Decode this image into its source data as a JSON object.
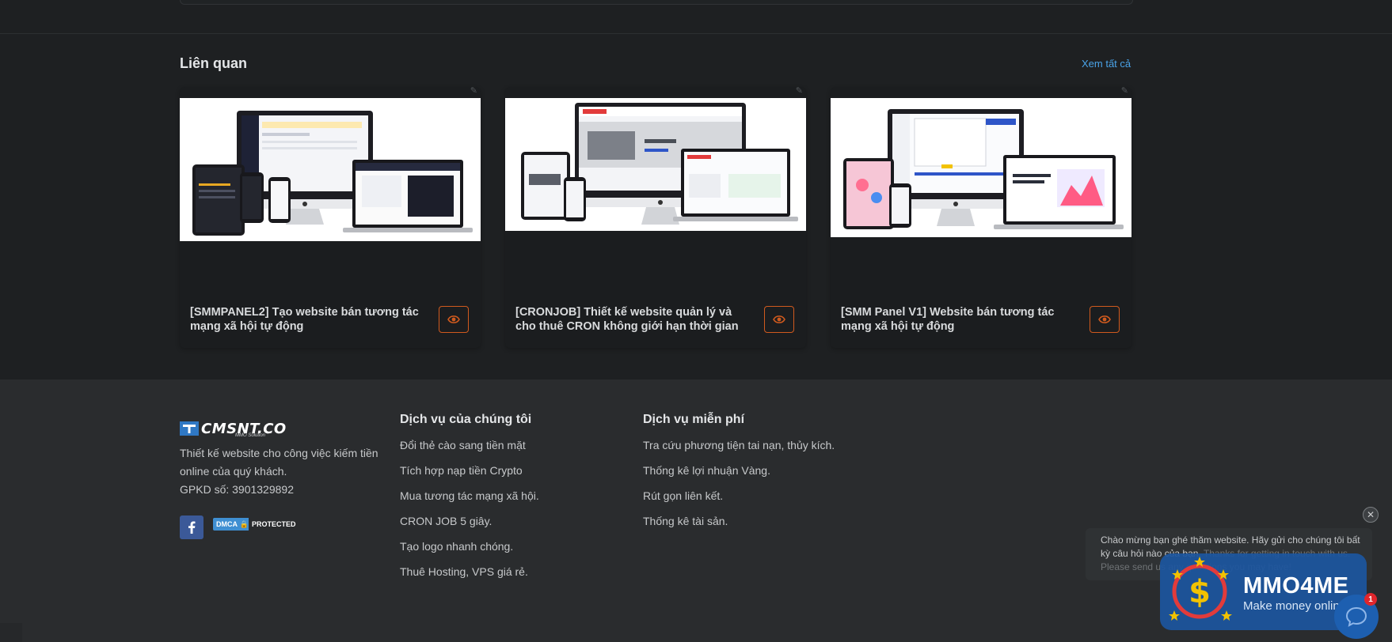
{
  "related": {
    "title": "Liên quan",
    "view_all": "Xem tất cả",
    "cards": [
      {
        "title": "[SMMPANEL2] Tạo website bán tương tác mạng xã hội tự động",
        "icon": "eye-icon"
      },
      {
        "title": "[CRONJOB] Thiết kế website quản lý và cho thuê CRON không giới hạn thời gian",
        "icon": "eye-icon"
      },
      {
        "title": "[SMM Panel V1] Website bán tương tác mạng xã hội tự động",
        "icon": "eye-icon"
      }
    ]
  },
  "footer": {
    "logo_text": "CMSNT.CO",
    "logo_sub": "MMO Solution",
    "about": "Thiết kế website cho công việc kiếm tiền online của quý khách.",
    "license": "GPKD số: 3901329892",
    "dmca_left": "DMCA",
    "dmca_right": "PROTECTED",
    "services_title": "Dịch vụ của chúng tôi",
    "services": [
      "Đổi thẻ cào sang tiền mặt",
      "Tích hợp nạp tiền Crypto",
      "Mua tương tác mạng xã hội.",
      "CRON JOB 5 giây.",
      "Tạo logo nhanh chóng.",
      "Thuê Hosting, VPS giá rẻ."
    ],
    "free_title": "Dịch vụ miễn phí",
    "free_services": [
      "Tra cứu phương tiện tai nạn, thủy kích.",
      "Thống kê lợi nhuận Vàng.",
      "Rút gọn liên kết.",
      "Thống kê tài sản."
    ]
  },
  "chat": {
    "message_vi": "Chào mừng bạn ghé thăm website. Hãy gửi cho chúng tôi bất kỳ câu hỏi nào của bạn.",
    "message_en": "Thanks for getting in touch with us. Please send us any questions you may have!",
    "badge": "1"
  },
  "watermark": {
    "title": "MMO4ME",
    "subtitle": "Make money online"
  },
  "colors": {
    "background": "#1e2022",
    "footer": "#2a2c2e",
    "accent_orange": "#d05a1e",
    "link_blue": "#4aa3e8",
    "facebook": "#3b5998"
  }
}
